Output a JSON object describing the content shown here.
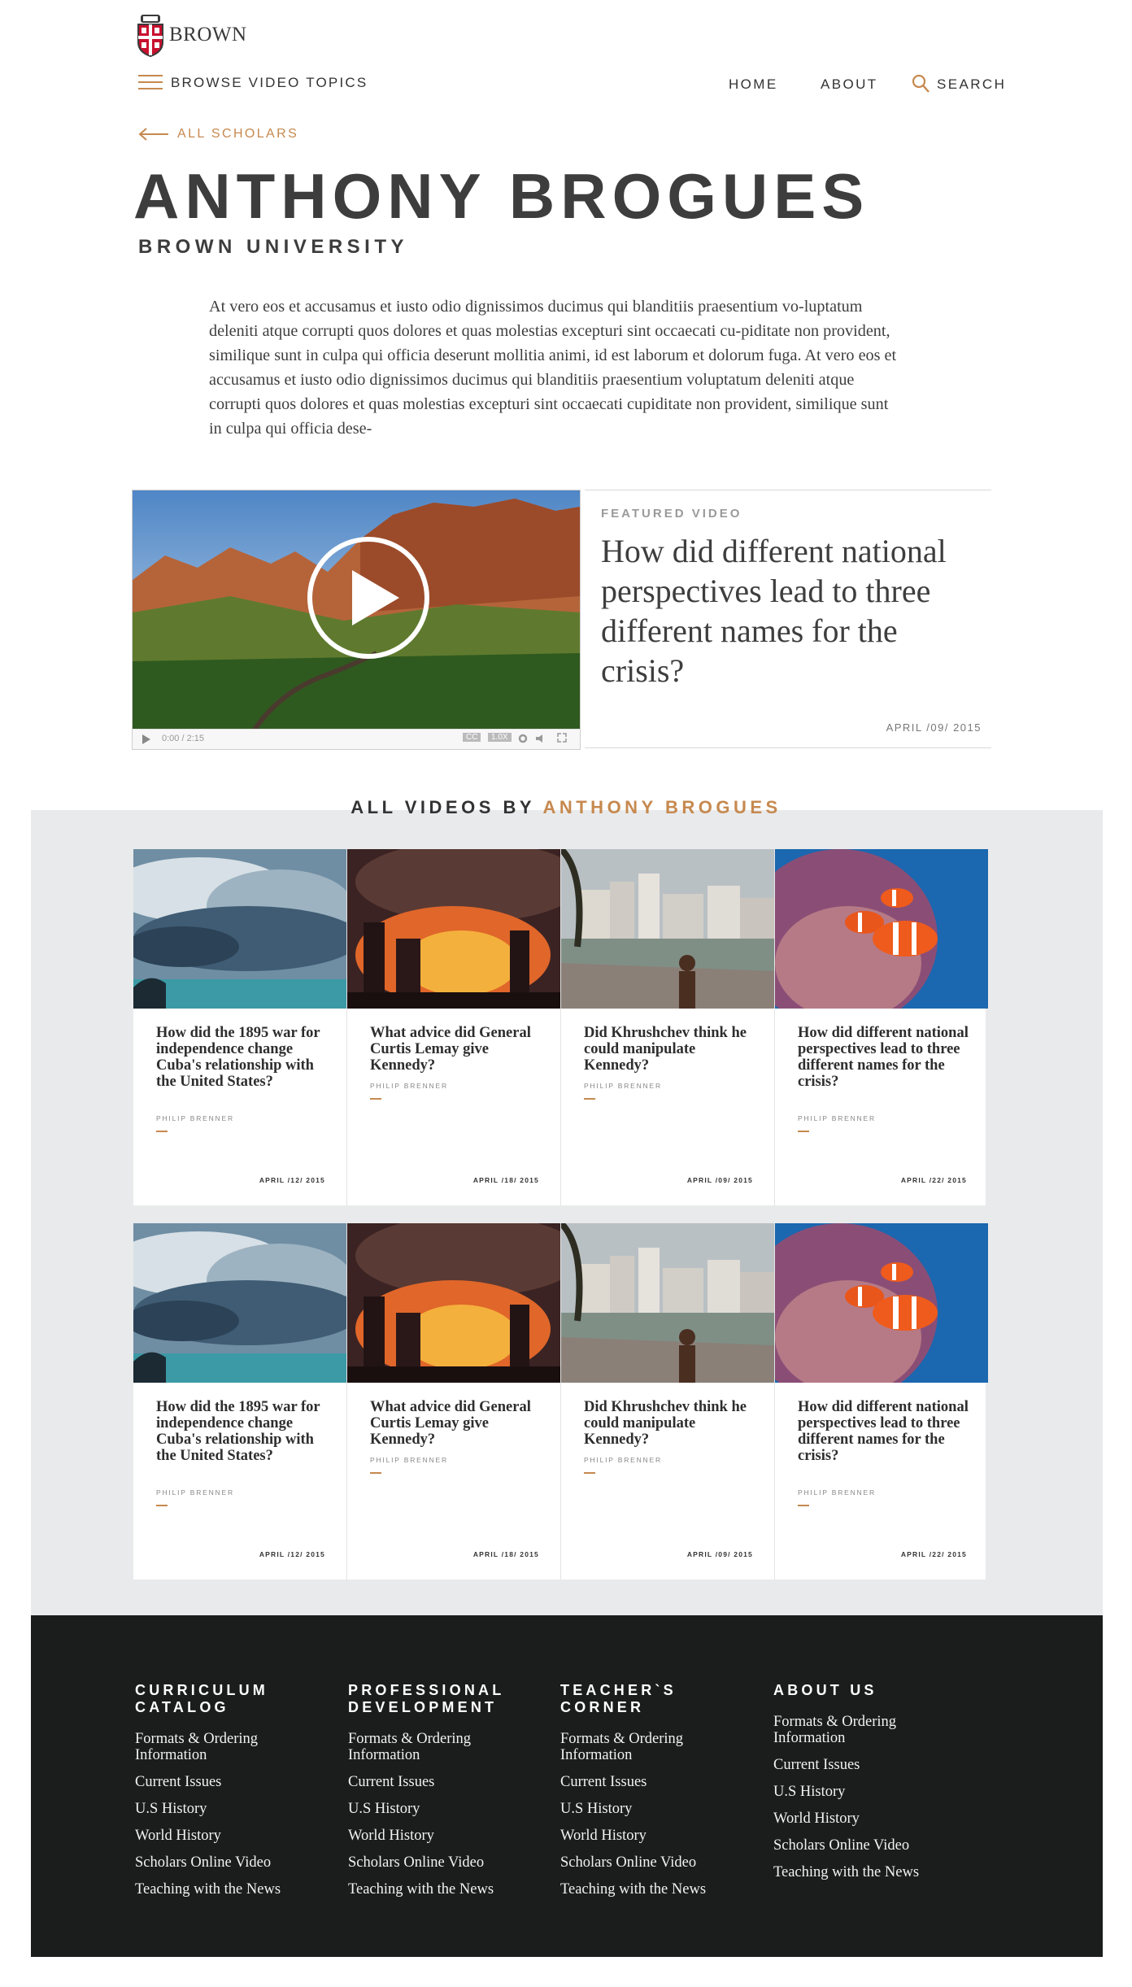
{
  "header": {
    "logo_text": "BROWN",
    "browse_label": "BROWSE VIDEO TOPICS",
    "nav": {
      "home": "HOME",
      "about": "ABOUT",
      "search": "SEARCH"
    },
    "back_label": "ALL SCHOLARS"
  },
  "scholar": {
    "name": "ANTHONY BROGUES",
    "institution": "BROWN UNIVERSITY",
    "bio": "At vero eos et accusamus et iusto odio dignissimos ducimus qui blanditiis praesentium vo-luptatum deleniti atque corrupti quos dolores et quas molestias excepturi sint occaecati cu-piditate non provident, similique sunt in culpa qui officia deserunt mollitia animi, id est laborum et dolorum fuga. At vero eos et accusamus et iusto odio dignissimos ducimus qui blanditiis praesentium voluptatum deleniti atque corrupti quos dolores et quas molestias excepturi sint occaecati cupiditate non provident, similique sunt in culpa qui officia dese-"
  },
  "featured": {
    "label": "FEATURED VIDEO",
    "title": "How did different national perspectives lead to three different names for the crisis?",
    "date": "APRIL /09/ 2015",
    "player": {
      "time": "0:00 / 2:15",
      "cc": "CC",
      "speed": "1.0X"
    }
  },
  "videos": {
    "heading_prefix": "ALL VIDEOS BY",
    "heading_name": "ANTHONY BROGUES",
    "rows": [
      [
        {
          "title": "How did the 1895 war for independence change Cuba's relationship with the United States?",
          "author": "PHILIP BRENNER",
          "date": "APRIL /12/ 2015",
          "image": "storm-sea"
        },
        {
          "title": "What advice did General Curtis Lemay give Kennedy?",
          "author": "PHILIP BRENNER",
          "date": "APRIL /18/ 2015",
          "image": "factory-fire"
        },
        {
          "title": "Did Khrushchev think he could manipulate Kennedy?",
          "author": "PHILIP BRENNER",
          "date": "APRIL /09/ 2015",
          "image": "river-city"
        },
        {
          "title": "How did different national perspectives lead to three different names for the crisis?",
          "author": "PHILIP BRENNER",
          "date": "APRIL /22/ 2015",
          "image": "clownfish"
        }
      ],
      [
        {
          "title": "How did the 1895 war for independence change Cuba's relationship with the United States?",
          "author": "PHILIP BRENNER",
          "date": "APRIL /12/ 2015",
          "image": "storm-sea"
        },
        {
          "title": "What advice did General Curtis Lemay give Kennedy?",
          "author": "PHILIP BRENNER",
          "date": "APRIL /18/ 2015",
          "image": "factory-fire"
        },
        {
          "title": "Did Khrushchev think he could manipulate Kennedy?",
          "author": "PHILIP BRENNER",
          "date": "APRIL /09/ 2015",
          "image": "river-city"
        },
        {
          "title": "How did different national perspectives lead to three different names for the crisis?",
          "author": "PHILIP BRENNER",
          "date": "APRIL /22/ 2015",
          "image": "clownfish"
        }
      ]
    ]
  },
  "footer": {
    "columns": [
      {
        "heading": "CURRICULUM CATALOG",
        "links": [
          "Formats & Ordering Information",
          "Current Issues",
          "U.S History",
          "World History",
          "Scholars Online Video",
          "Teaching with the News"
        ]
      },
      {
        "heading": "PROFESSIONAL DEVELOPMENT",
        "links": [
          "Formats & Ordering Information",
          "Current Issues",
          "U.S History",
          "World History",
          "Scholars Online Video",
          "Teaching with the News"
        ]
      },
      {
        "heading": "TEACHER`S CORNER",
        "links": [
          "Formats & Ordering Information",
          "Current Issues",
          "U.S History",
          "World History",
          "Scholars Online Video",
          "Teaching with the News"
        ]
      },
      {
        "heading": "ABOUT US",
        "links": [
          "Formats & Ordering Information",
          "Current Issues",
          "U.S History",
          "World History",
          "Scholars Online Video",
          "Teaching with the News"
        ]
      }
    ]
  },
  "colors": {
    "accent": "#c6894f",
    "text": "#3d3d3d",
    "section_bg": "#e9eaeb",
    "footer_bg": "#1b1c1c"
  }
}
